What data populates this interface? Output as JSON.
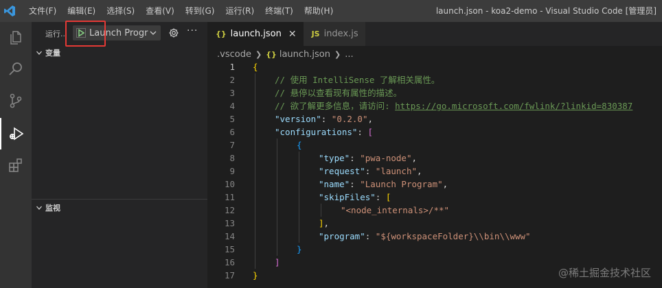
{
  "menu": [
    "文件(F)",
    "编辑(E)",
    "选择(S)",
    "查看(V)",
    "转到(G)",
    "运行(R)",
    "终端(T)",
    "帮助(H)"
  ],
  "window_title": "launch.json - koa2-demo - Visual Studio Code [管理员]",
  "sidebar": {
    "title": "运行..",
    "launch_config": "Launch Program",
    "more": "···",
    "variables_label": "变量",
    "watch_label": "监视"
  },
  "tabs": [
    {
      "icon": "{}",
      "label": "launch.json",
      "close": "✕"
    },
    {
      "icon": "JS",
      "label": "index.js"
    }
  ],
  "breadcrumb": {
    "folder": ".vscode",
    "file_icon": "{}",
    "file": "launch.json",
    "tail": "..."
  },
  "code": {
    "line_numbers": [
      "1",
      "2",
      "3",
      "4",
      "5",
      "6",
      "7",
      "8",
      "9",
      "10",
      "11",
      "12",
      "13",
      "14",
      "15",
      "16",
      "17"
    ],
    "l1_brace": "{",
    "l2_comment": "// 使用 IntelliSense 了解相关属性。",
    "l3_comment": "// 悬停以查看现有属性的描述。",
    "l4_comment": "// 欲了解更多信息，请访问: ",
    "l4_link": "https://go.microsoft.com/fwlink/?linkid=830387",
    "l5_key": "\"version\"",
    "l5_val": "\"0.2.0\"",
    "l6_key": "\"configurations\"",
    "l6_open": "[",
    "l7_brace": "{",
    "l8_key": "\"type\"",
    "l8_val": "\"pwa-node\"",
    "l9_key": "\"request\"",
    "l9_val": "\"launch\"",
    "l10_key": "\"name\"",
    "l10_val": "\"Launch Program\"",
    "l11_key": "\"skipFiles\"",
    "l11_open": "[",
    "l12_val": "\"<node_internals>/**\"",
    "l13_close": "]",
    "l14_key": "\"program\"",
    "l14_val": "\"${workspaceFolder}\\\\bin\\\\www\"",
    "l15_brace": "}",
    "l16_close": "]",
    "l17_brace": "}"
  },
  "watermark": "@稀土掘金技术社区",
  "colors": {
    "accent_highlight": "#e53935",
    "play_icon": "#89d185"
  }
}
